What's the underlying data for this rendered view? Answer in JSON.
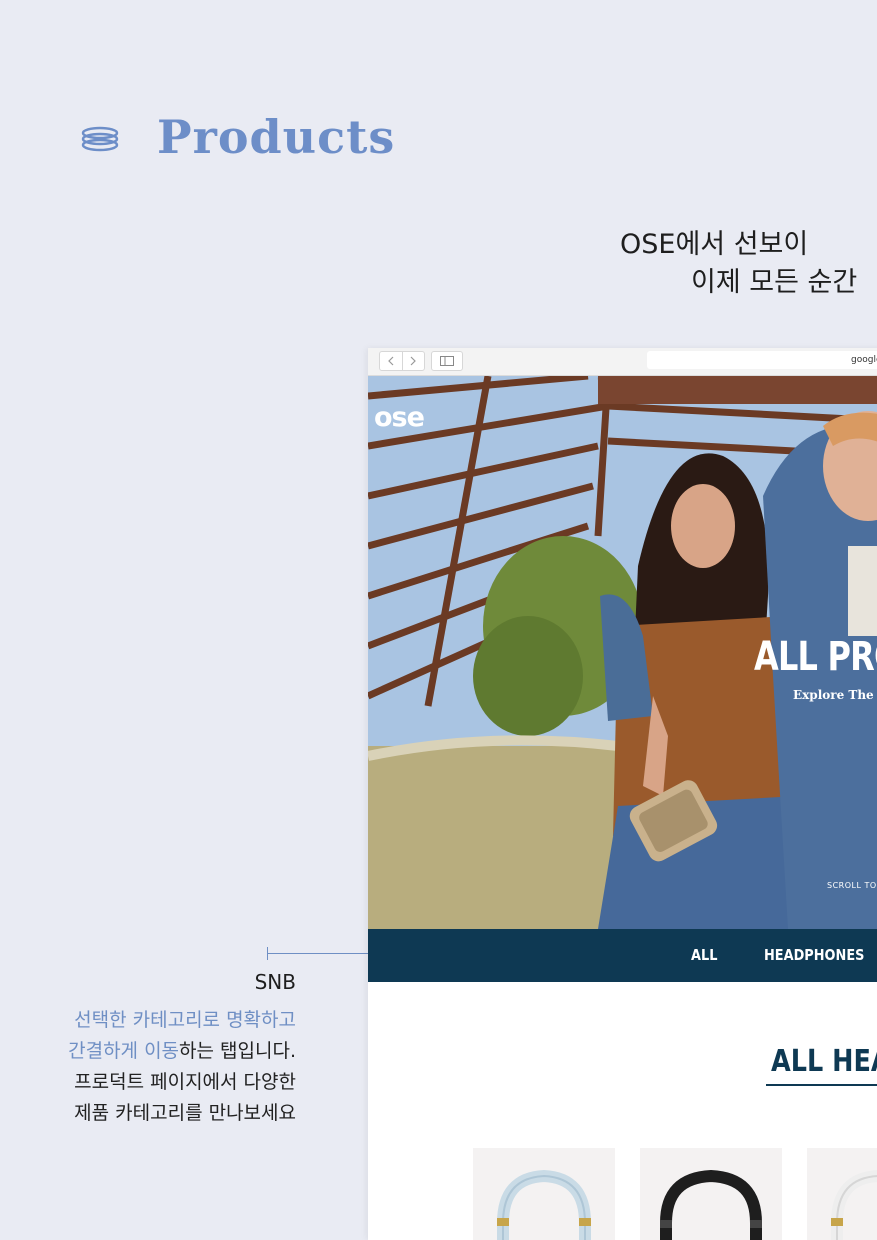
{
  "header": {
    "title": "Products",
    "title_icon": "layers-icon"
  },
  "intro": {
    "line1": "OSE에서 선보이",
    "line2": "이제 모든 순간"
  },
  "snb_annotation": {
    "label": "SNB",
    "desc_highlight_1": "선택한 카테고리로 명확하고",
    "desc_highlight_2": "간결하게 이동",
    "desc_rest_2": "하는 탭입니다.",
    "desc_line3": "프로덕트 페이지에서 다양한",
    "desc_line4": "제품 카테고리를 만나보세요"
  },
  "browser": {
    "url": "google",
    "nav_icons": [
      "back-icon",
      "forward-icon",
      "sidebar-icon"
    ]
  },
  "site": {
    "logo": "ose",
    "hero_title": "ALL PRO",
    "hero_subtitle": "Explore The Sig",
    "scroll_cue": "SCROLL TO",
    "snb_tabs": [
      "ALL",
      "HEADPHONES"
    ],
    "section_title": "ALL HEAD"
  },
  "colors": {
    "background": "#e9ebf3",
    "accent": "#6f8fc4",
    "navy": "#0e3953"
  }
}
